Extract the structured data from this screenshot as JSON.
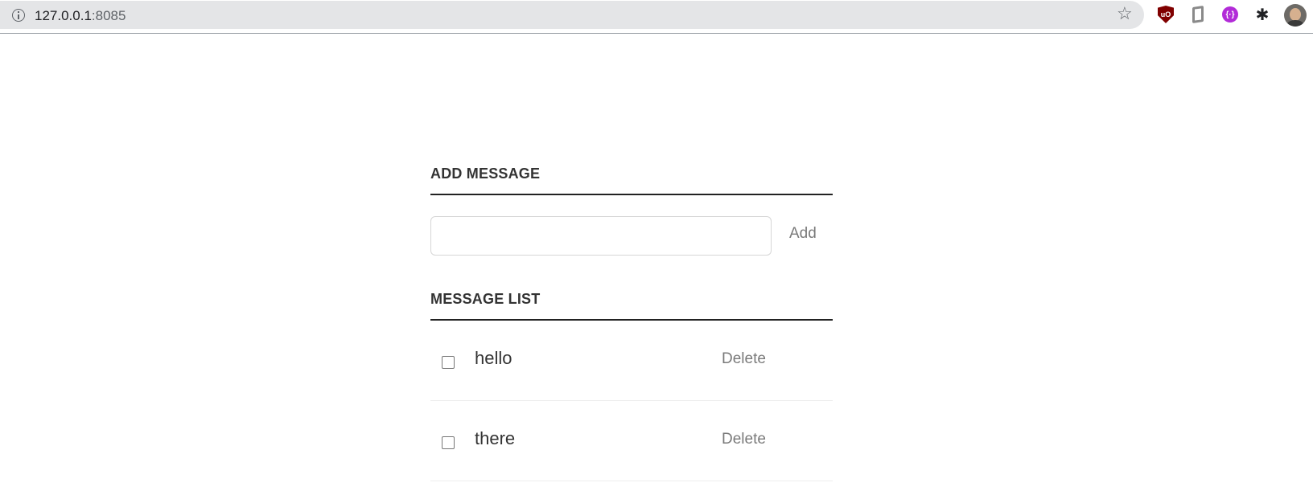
{
  "browser": {
    "url_host": "127.0.0.1",
    "url_port": ":8085",
    "extensions": [
      "ublock-icon",
      "office-icon",
      "purple-extension-icon",
      "puzzle-icon"
    ],
    "ublock_label": "uO"
  },
  "add_section": {
    "title": "ADD MESSAGE",
    "input_value": "",
    "input_placeholder": "",
    "add_label": "Add"
  },
  "list_section": {
    "title": "MESSAGE LIST",
    "items": [
      {
        "text": "hello",
        "checked": false,
        "delete_label": "Delete"
      },
      {
        "text": "there",
        "checked": false,
        "delete_label": "Delete"
      }
    ]
  }
}
